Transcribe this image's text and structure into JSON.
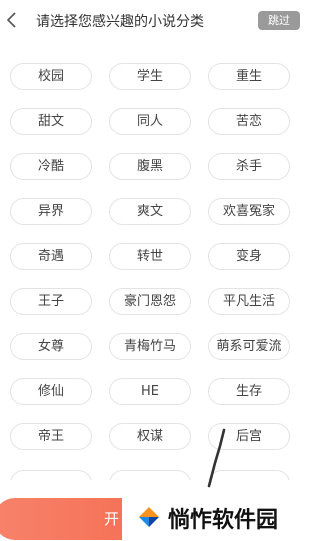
{
  "header": {
    "title": "请选择您感兴趣的小说分类",
    "skip_label": "跳过"
  },
  "tags": [
    [
      "校园",
      "学生",
      "重生"
    ],
    [
      "甜文",
      "同人",
      "苦恋"
    ],
    [
      "冷酷",
      "腹黑",
      "杀手"
    ],
    [
      "异界",
      "爽文",
      "欢喜冤家"
    ],
    [
      "奇遇",
      "转世",
      "变身"
    ],
    [
      "王子",
      "豪门恩怨",
      "平凡生活"
    ],
    [
      "女尊",
      "青梅竹马",
      "萌系可爱流"
    ],
    [
      "修仙",
      "HE",
      "生存"
    ],
    [
      "帝王",
      "权谋",
      "后宫"
    ]
  ],
  "bottom_button": {
    "label": "开"
  },
  "watermark": {
    "text": "惝怍软件园"
  },
  "colors": {
    "accent_start": "#f7826a",
    "accent_end": "#f25f3f",
    "skip_bg": "#9a9a9a",
    "tag_border": "#e3e3e3"
  }
}
